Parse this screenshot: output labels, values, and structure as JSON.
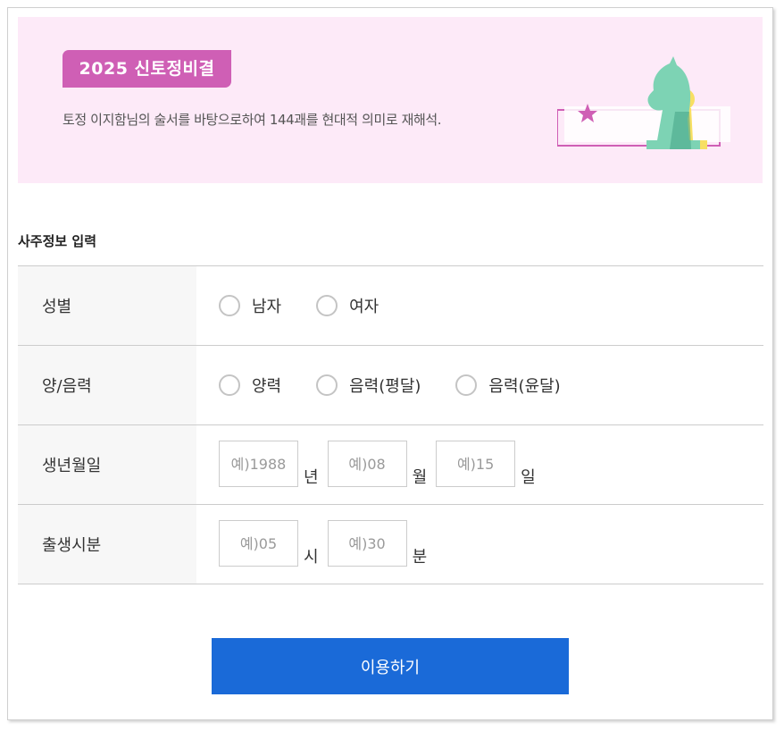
{
  "banner": {
    "badge": "2025 신토정비결",
    "description": "토정 이지함님의 술서를 바탕으로하여 144괘를 현대적 의미로 재해석."
  },
  "section_title": "사주정보 입력",
  "gender": {
    "label": "성별",
    "options": [
      "남자",
      "여자"
    ]
  },
  "calendar": {
    "label": "양/음력",
    "options": [
      "양력",
      "음력(평달)",
      "음력(윤달)"
    ]
  },
  "birthdate": {
    "label": "생년월일",
    "year_placeholder": "예)1988",
    "year_unit": "년",
    "month_placeholder": "예)08",
    "month_unit": "월",
    "day_placeholder": "예)15",
    "day_unit": "일"
  },
  "birthtime": {
    "label": "출생시분",
    "hour_placeholder": "예)05",
    "hour_unit": "시",
    "minute_placeholder": "예)30",
    "minute_unit": "분"
  },
  "submit_label": "이용하기",
  "colors": {
    "banner_bg": "#fdeaf8",
    "badge": "#cf5fb5",
    "button": "#1a6ad8",
    "label_bg": "#f7f7f7"
  },
  "icons": {
    "banner_art": "chess-knight-pawn-illustration"
  }
}
